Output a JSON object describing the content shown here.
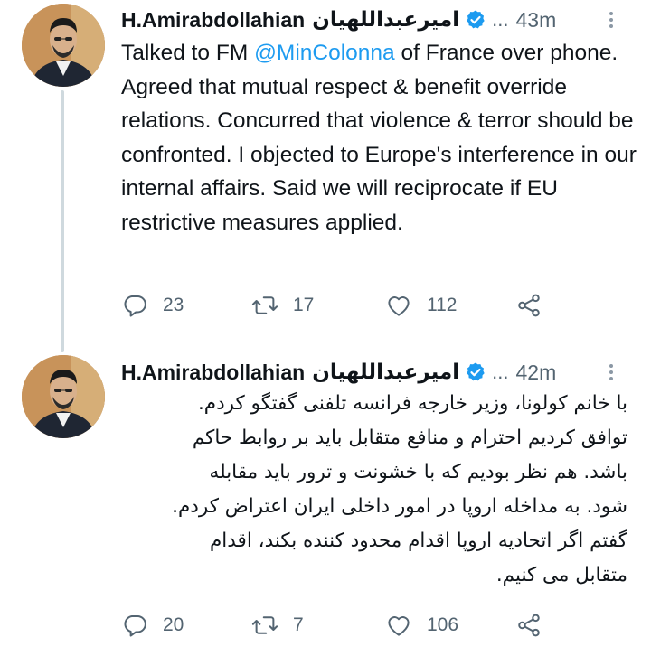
{
  "tweets": [
    {
      "author_name": "H.Amirabdollahian",
      "author_name_fa": "امیرعبداللهیان",
      "separator": "...",
      "time": "43m",
      "text_prefix": "Talked to FM ",
      "mention": "@MinColonna",
      "text_suffix": " of France over phone. Agreed that mutual respect & benefit override relations. Concurred that violence & terror should be confronted. I objected to Europe's interference in our internal affairs. Said we will reciprocate if EU restrictive measures applied.",
      "replies": "23",
      "retweets": "17",
      "likes": "112"
    },
    {
      "author_name": "H.Amirabdollahian",
      "author_name_fa": "امیرعبداللهیان",
      "separator": "...",
      "time": "42m",
      "text_lines": [
        "با خانم کولونا، وزیر خارجه فرانسه تلفنی گفتگو کردم.",
        "توافق کردیم احترام و منافع متقابل باید بر روابط حاکم",
        "باشد. هم نظر بودیم که با خشونت و ترور باید مقابله",
        "شود. به مداخله اروپا در امور داخلی ایران اعتراض کردم.",
        "گفتم اگر اتحادیه اروپا اقدام محدود کننده بکند، اقدام",
        "متقابل می کنیم."
      ],
      "replies": "20",
      "retweets": "7",
      "likes": "106"
    }
  ],
  "colors": {
    "accent": "#1d9bf0",
    "muted": "#536471",
    "text": "#0f1419"
  },
  "icons": [
    "reply-icon",
    "retweet-icon",
    "like-icon",
    "share-icon",
    "verified-icon",
    "more-icon"
  ]
}
